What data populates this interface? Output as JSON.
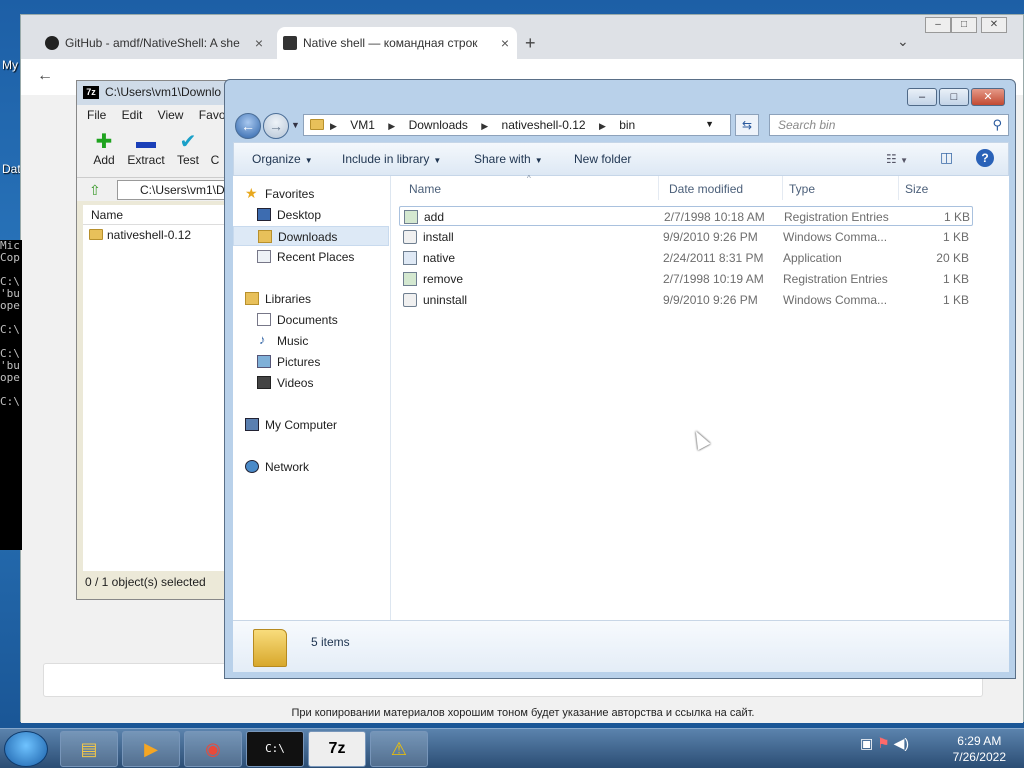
{
  "desktop": {
    "label_my": "My",
    "label_dat": "Dat"
  },
  "chrome": {
    "tabs": [
      {
        "label": "GitHub - amdf/NativeShell: A she",
        "close": "×"
      },
      {
        "label": "Native shell — командная строк",
        "close": "×"
      }
    ],
    "new_tab": "+",
    "tab_menu": "⌄",
    "footer_note": "При копировании материалов хорошим тоном будет указание авторства и ссылка на сайт."
  },
  "console": {
    "lines": [
      "Mic",
      "Cop",
      "",
      "C:\\",
      "'bu",
      "ope",
      "",
      "C:\\",
      "",
      "C:\\",
      "'bu",
      "ope",
      "",
      "C:\\"
    ]
  },
  "sevenzip": {
    "title": "C:\\Users\\vm1\\Downlo",
    "menu": "File Edit View Favo",
    "tools": [
      {
        "label": "Add",
        "glyph": "✚",
        "color": "#1fa31f"
      },
      {
        "label": "Extract",
        "glyph": "▬",
        "color": "#1a3fb8"
      },
      {
        "label": "Test",
        "glyph": "✔",
        "color": "#1aa0c8"
      },
      {
        "label": "C",
        "glyph": "",
        "color": "#000000"
      }
    ],
    "path": "C:\\Users\\vm1\\D",
    "col_name": "Name",
    "items": [
      "nativeshell-0.12"
    ],
    "status": "0 / 1 object(s) selected"
  },
  "explorer": {
    "breadcrumb": [
      "VM1",
      "Downloads",
      "nativeshell-0.12",
      "bin"
    ],
    "search_placeholder": "Search bin",
    "commands": {
      "organize": "Organize",
      "include": "Include in library",
      "share": "Share with",
      "new_folder": "New folder"
    },
    "nav": {
      "favorites": "Favorites",
      "favorites_items": [
        "Desktop",
        "Downloads",
        "Recent Places"
      ],
      "libraries": "Libraries",
      "libraries_items": [
        "Documents",
        "Music",
        "Pictures",
        "Videos"
      ],
      "computer": "My Computer",
      "network": "Network"
    },
    "columns": {
      "name": "Name",
      "date": "Date modified",
      "type": "Type",
      "size": "Size"
    },
    "files": [
      {
        "name": "add",
        "date": "2/7/1998 10:18 AM",
        "type": "Registration Entries",
        "size": "1 KB",
        "icon": "reg"
      },
      {
        "name": "install",
        "date": "9/9/2010 9:26 PM",
        "type": "Windows Comma...",
        "size": "1 KB",
        "icon": "cmd"
      },
      {
        "name": "native",
        "date": "2/24/2011 8:31 PM",
        "type": "Application",
        "size": "20 KB",
        "icon": "app"
      },
      {
        "name": "remove",
        "date": "2/7/1998 10:19 AM",
        "type": "Registration Entries",
        "size": "1 KB",
        "icon": "reg"
      },
      {
        "name": "uninstall",
        "date": "9/9/2010 9:26 PM",
        "type": "Windows Comma...",
        "size": "1 KB",
        "icon": "cmd"
      }
    ],
    "item_count": "5 items"
  },
  "taskbar": {
    "time": "6:29 AM",
    "date": "7/26/2022",
    "buttons": [
      {
        "name": "explorer",
        "glyph": "▤"
      },
      {
        "name": "media-player",
        "glyph": "▶"
      },
      {
        "name": "chrome",
        "glyph": "◉"
      },
      {
        "name": "cmd",
        "glyph": "C:\\"
      },
      {
        "name": "7zip",
        "glyph": "7z"
      },
      {
        "name": "warning",
        "glyph": "⚠"
      }
    ]
  }
}
